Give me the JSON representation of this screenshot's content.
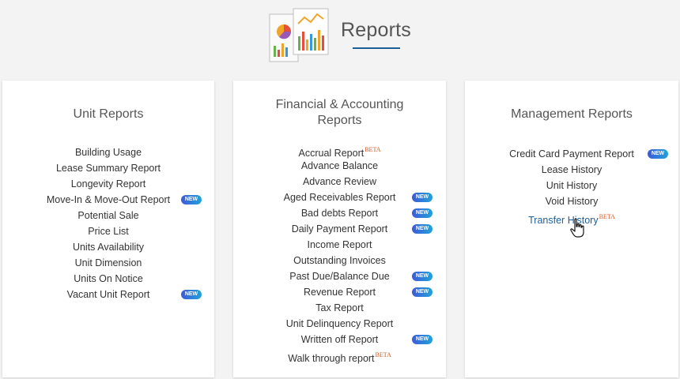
{
  "header": {
    "title": "Reports",
    "accent_color": "#1f5f99"
  },
  "unit_reports": {
    "title": "Unit Reports",
    "items": [
      {
        "label": "Building Usage",
        "badge": ""
      },
      {
        "label": "Lease Summary Report",
        "badge": ""
      },
      {
        "label": "Longevity Report",
        "badge": ""
      },
      {
        "label": "Move-In & Move-Out Report",
        "badge": "NEW"
      },
      {
        "label": "Potential Sale",
        "badge": ""
      },
      {
        "label": "Price List",
        "badge": ""
      },
      {
        "label": "Units Availability",
        "badge": ""
      },
      {
        "label": "Unit Dimension",
        "badge": ""
      },
      {
        "label": "Units On Notice",
        "badge": ""
      },
      {
        "label": "Vacant Unit Report",
        "badge": "NEW"
      }
    ]
  },
  "financial_reports": {
    "title_line1": "Financial & Accounting",
    "title_line2": "Reports",
    "items": [
      {
        "label": "Accrual Report",
        "sup": "BETA",
        "badge": ""
      },
      {
        "label": "Advance Balance",
        "sup": "",
        "badge": ""
      },
      {
        "label": "Advance Review",
        "sup": "",
        "badge": ""
      },
      {
        "label": "Aged Receivables Report",
        "sup": "",
        "badge": "NEW"
      },
      {
        "label": "Bad debts Report",
        "sup": "",
        "badge": "NEW"
      },
      {
        "label": "Daily Payment Report",
        "sup": "",
        "badge": "NEW"
      },
      {
        "label": "Income Report",
        "sup": "",
        "badge": ""
      },
      {
        "label": "Outstanding Invoices",
        "sup": "",
        "badge": ""
      },
      {
        "label": "Past Due/Balance Due",
        "sup": "",
        "badge": "NEW"
      },
      {
        "label": "Revenue Report",
        "sup": "",
        "badge": "NEW"
      },
      {
        "label": "Tax Report",
        "sup": "",
        "badge": ""
      },
      {
        "label": "Unit Delinquency Report",
        "sup": "",
        "badge": ""
      },
      {
        "label": "Written off Report",
        "sup": "",
        "badge": "NEW"
      },
      {
        "label": "Walk through report",
        "sup": "BETA",
        "badge": ""
      }
    ]
  },
  "management_reports": {
    "title": "Management Reports",
    "items": [
      {
        "label": "Credit Card Payment Report",
        "sup": "",
        "badge": "NEW"
      },
      {
        "label": "Lease History",
        "sup": "",
        "badge": ""
      },
      {
        "label": "Unit History",
        "sup": "",
        "badge": ""
      },
      {
        "label": "Void History",
        "sup": "",
        "badge": ""
      },
      {
        "label": "Transfer History",
        "sup": "BETA",
        "badge": ""
      }
    ]
  },
  "icons": {
    "header": "reports-charts-icon",
    "cursor": "hand-pointer-icon"
  }
}
